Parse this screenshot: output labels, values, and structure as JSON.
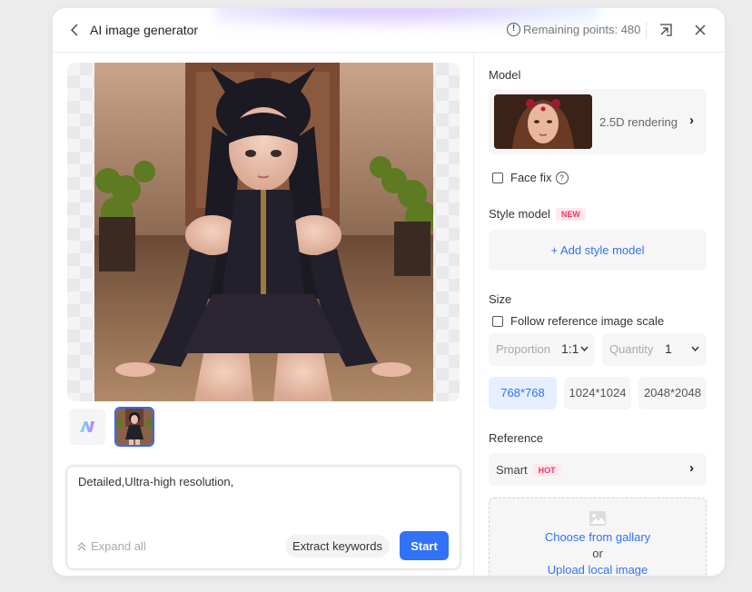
{
  "header": {
    "title": "AI image generator",
    "remaining_points_label": "Remaining points: 480",
    "icons": {
      "back": "chevron-left-icon",
      "info": "info-icon",
      "pin": "pin-window-icon",
      "close": "close-icon"
    }
  },
  "preview": {
    "thumbnails": [
      {
        "kind": "logo",
        "icon": "app-logo-icon"
      },
      {
        "kind": "image",
        "selected": true
      }
    ]
  },
  "prompt": {
    "value": "Detailed,Ultra-high resolution,",
    "expand_label": "Expand all",
    "extract_label": "Extract keywords",
    "start_label": "Start"
  },
  "settings": {
    "model": {
      "label": "Model",
      "selected_name": "2.5D rendering",
      "face_fix_label": "Face fix",
      "face_fix_checked": false
    },
    "style_model": {
      "label": "Style model",
      "badge": "NEW",
      "add_label": "+ Add style model"
    },
    "size": {
      "label": "Size",
      "follow_reference_label": "Follow reference image scale",
      "follow_reference_checked": false,
      "proportion_label": "Proportion",
      "proportion_value": "1:1",
      "quantity_label": "Quantity",
      "quantity_value": "1",
      "options": [
        "768*768",
        "1024*1024",
        "2048*2048"
      ],
      "selected_option": "768*768"
    },
    "reference": {
      "label": "Reference",
      "mode": "Smart",
      "badge": "HOT",
      "choose_gallery_label": "Choose from gallary",
      "or_label": "or",
      "upload_local_label": "Upload local image"
    }
  },
  "colors": {
    "accent": "#3172f6",
    "badge_bg": "#ffe9ee",
    "badge_text": "#f0355e",
    "card_bg": "#f6f6f7"
  }
}
